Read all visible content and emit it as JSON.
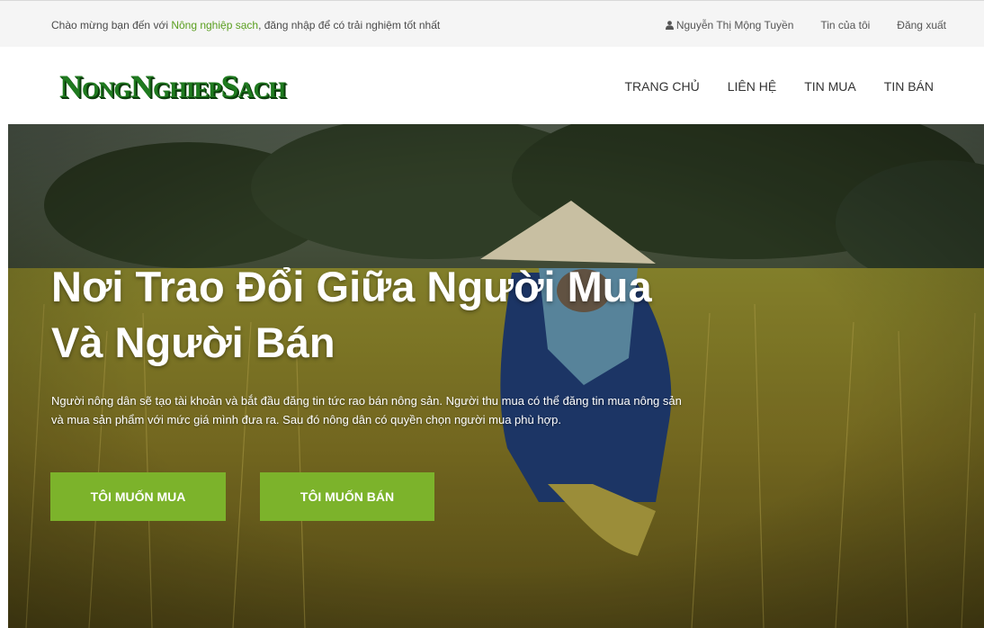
{
  "topbar": {
    "welcome_prefix": "Chào mừng bạn đến với ",
    "welcome_brand": "Nông nghiệp sạch",
    "welcome_suffix": ", đăng nhập để có trải nghiệm tốt nhất",
    "user_icon": "user-icon",
    "user_name": "Nguyễn Thị Mộng Tuyền",
    "my_posts": "Tin của tôi",
    "logout": "Đăng xuất"
  },
  "header": {
    "logo_text": "NongNghiepSach",
    "nav": [
      "TRANG CHỦ",
      "LIÊN HỆ",
      "TIN MUA",
      "TIN BÁN"
    ]
  },
  "hero": {
    "title_line1": "Nơi Trao Đổi Giữa Người Mua",
    "title_line2": "Và Người Bán",
    "description_line1": "Người nông dân sẽ tạo tài khoản và bắt đầu đăng tin tức rao bán nông sản. Người thu mua có thể đăng tin mua nông sản",
    "description_line2": "và mua sản phẩm với mức giá mình đưa ra. Sau đó nông dân có quyền chọn người mua phù hợp.",
    "buy_button": "TÔI MUỐN MUA",
    "sell_button": "TÔI MUỐN BÁN"
  },
  "colors": {
    "accent_green": "#7cb32b",
    "brand_link": "#5a9e1f",
    "logo_green": "#1f7a1f"
  }
}
